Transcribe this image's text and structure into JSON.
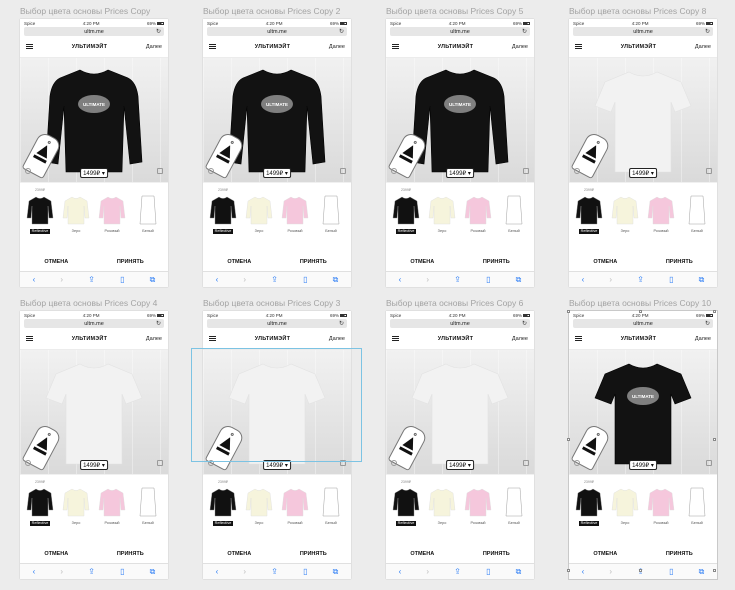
{
  "boards": [
    {
      "title": "Выбор цвета основы Prices Copy",
      "garment": "sweatshirt",
      "color": "#121212",
      "logo": "ULTIMATE"
    },
    {
      "title": "Выбор цвета основы Prices Copy 2",
      "garment": "sweatshirt",
      "color": "#121212",
      "logo": "ULTIMATE"
    },
    {
      "title": "Выбор цвета основы Prices Copy 5",
      "garment": "sweatshirt",
      "color": "#121212",
      "logo": "ULTIMATE"
    },
    {
      "title": "Выбор цвета основы Prices Copy 8",
      "garment": "tshirt",
      "color": "#f2f2f2",
      "logo": ""
    },
    {
      "title": "Выбор цвета основы Prices Copy 4",
      "garment": "tshirt",
      "color": "#f2f2f2",
      "logo": ""
    },
    {
      "title": "Выбор цвета основы Prices Copy 3",
      "garment": "tshirt",
      "color": "#f2f2f2",
      "logo": ""
    },
    {
      "title": "Выбор цвета основы Prices Copy 6",
      "garment": "tshirt",
      "color": "#f2f2f2",
      "logo": ""
    },
    {
      "title": "Выбор цвета основы Prices Copy 10",
      "garment": "tshirt",
      "color": "#121212",
      "logo": "ULTIMATE"
    }
  ],
  "phone": {
    "carrier": "Spice",
    "time": "4:20 PM",
    "battery": "69%",
    "url": "ultm.me",
    "nav_title": "УЛЬТИМЭЙТ",
    "nav_next": "Далее",
    "price": "1499₽ ▾",
    "cancel": "ОТМЕНА",
    "accept": "ПРИНЯТЬ",
    "toolbar_icons": [
      "back-icon",
      "forward-icon",
      "share-icon",
      "bookmarks-icon",
      "tabs-icon"
    ]
  },
  "swatches": [
    {
      "price": "2399₽",
      "label": "Reflective",
      "color": "#111111",
      "active": true
    },
    {
      "price": "",
      "label": "Зеро",
      "color": "#f6f4dc",
      "active": false
    },
    {
      "price": "",
      "label": "Розовый",
      "color": "#f5c7dc",
      "active": false
    },
    {
      "price": "",
      "label": "Белый",
      "color": "#ffffff",
      "active": false
    }
  ],
  "colors": {
    "accent": "#2f7ff5",
    "selection": "#7cc3e3",
    "background": "#ececec"
  }
}
